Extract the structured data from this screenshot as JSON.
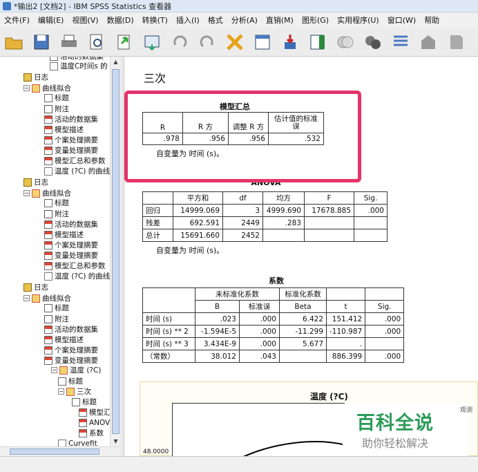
{
  "window": {
    "title": "*输出2 [文档2] - IBM SPSS Statistics 查看器"
  },
  "menu": [
    "文件(F)",
    "编辑(E)",
    "视图(V)",
    "数据(D)",
    "转换(T)",
    "插入(I)",
    "格式",
    "分析(A)",
    "直销(M)",
    "图形(G)",
    "实用程序(U)",
    "窗口(W)",
    "帮助"
  ],
  "toolbar": {
    "icons": [
      "open-folder-icon",
      "save-icon",
      "print-icon",
      "print-preview-icon",
      "export-icon",
      "recall-dialog-icon",
      "undo-icon",
      "redo-icon",
      "goto-data-icon",
      "goto-case-icon",
      "goto-variable-icon",
      "variables-icon",
      "insert-output-icon",
      "run-script-icon",
      "designate-window-icon",
      "show-icon",
      "hide-icon",
      "promote-icon",
      "demote-icon"
    ]
  },
  "tree": {
    "items": [
      {
        "label": "活动的数据集",
        "icon": "table"
      },
      {
        "label": "温度C时间s 的",
        "icon": "chart"
      },
      {
        "label": "日志",
        "icon": "log"
      },
      {
        "label": "曲线拟合",
        "icon": "fit"
      },
      {
        "label": "标题",
        "icon": "title"
      },
      {
        "label": "附注",
        "icon": "note"
      },
      {
        "label": "活动的数据集",
        "icon": "table"
      },
      {
        "label": "模型描述",
        "icon": "table"
      },
      {
        "label": "个案处理摘要",
        "icon": "table"
      },
      {
        "label": "变量处理摘要",
        "icon": "table"
      },
      {
        "label": "模型汇总和参数",
        "icon": "table"
      },
      {
        "label": "温度 (?C) 的曲线",
        "icon": "chart"
      },
      {
        "label": "日志",
        "icon": "log"
      },
      {
        "label": "曲线拟合",
        "icon": "fit"
      },
      {
        "label": "标题",
        "icon": "title"
      },
      {
        "label": "附注",
        "icon": "note"
      },
      {
        "label": "活动的数据集",
        "icon": "table"
      },
      {
        "label": "模型描述",
        "icon": "table"
      },
      {
        "label": "个案处理摘要",
        "icon": "table"
      },
      {
        "label": "变量处理摘要",
        "icon": "table"
      },
      {
        "label": "模型汇总和参数",
        "icon": "table"
      },
      {
        "label": "温度 (?C) 的曲线",
        "icon": "chart"
      },
      {
        "label": "日志",
        "icon": "log"
      },
      {
        "label": "曲线拟合",
        "icon": "fit"
      },
      {
        "label": "标题",
        "icon": "title"
      },
      {
        "label": "附注",
        "icon": "note"
      },
      {
        "label": "活动的数据集",
        "icon": "table"
      },
      {
        "label": "模型描述",
        "icon": "table"
      },
      {
        "label": "个案处理摘要",
        "icon": "table"
      },
      {
        "label": "变量处理摘要",
        "icon": "table"
      },
      {
        "label": "温度 (?C)",
        "icon": "fit"
      },
      {
        "label": "标题",
        "icon": "title"
      },
      {
        "label": "三次",
        "icon": "fit"
      },
      {
        "label": "标题",
        "icon": "title"
      },
      {
        "label": "模型汇",
        "icon": "table"
      },
      {
        "label": "ANOVA",
        "icon": "table"
      },
      {
        "label": "系数",
        "icon": "table"
      },
      {
        "label": "Curvefit",
        "icon": "chart"
      }
    ]
  },
  "output": {
    "heading": "三次",
    "model_summary": {
      "title": "模型汇总",
      "headers": [
        "R",
        "R 方",
        "调整 R 方",
        "估计值的标准误"
      ],
      "row": [
        ".978",
        ".956",
        ".956",
        ".532"
      ],
      "footnote": "自变量为 时间 (s)。"
    },
    "anova": {
      "title": "ANOVA",
      "headers": [
        "",
        "平方和",
        "df",
        "均方",
        "F",
        "Sig."
      ],
      "rows": [
        [
          "回归",
          "14999.069",
          "3",
          "4999.690",
          "17678.885",
          ".000"
        ],
        [
          "残差",
          "692.591",
          "2449",
          ".283",
          "",
          ""
        ],
        [
          "总计",
          "15691.660",
          "2452",
          "",
          "",
          ""
        ]
      ],
      "footnote": "自变量为 时间 (s)。"
    },
    "coefficients": {
      "title": "系数",
      "group_headers": [
        "未标准化系数",
        "标准化系数"
      ],
      "sub_headers": [
        "B",
        "标准误",
        "Beta",
        "t",
        "Sig."
      ],
      "rows": [
        [
          "时间 (s)",
          ".023",
          ".000",
          "6.422",
          "151.412",
          ".000"
        ],
        [
          "时间 (s) ** 2",
          "-1.594E-5",
          ".000",
          "-11.299",
          "-110.987",
          ".000"
        ],
        [
          "时间 (s) ** 3",
          "3.434E-9",
          ".000",
          "5.677",
          ".",
          ""
        ],
        [
          "（常数）",
          "38.012",
          ".043",
          "",
          "886.399",
          ".000"
        ]
      ]
    },
    "chart": {
      "title": "温度 (?C)",
      "y_tick": "48.0000"
    }
  },
  "watermark": {
    "main": "百科全说",
    "sub": "助你轻松解决",
    "side": "观测"
  }
}
